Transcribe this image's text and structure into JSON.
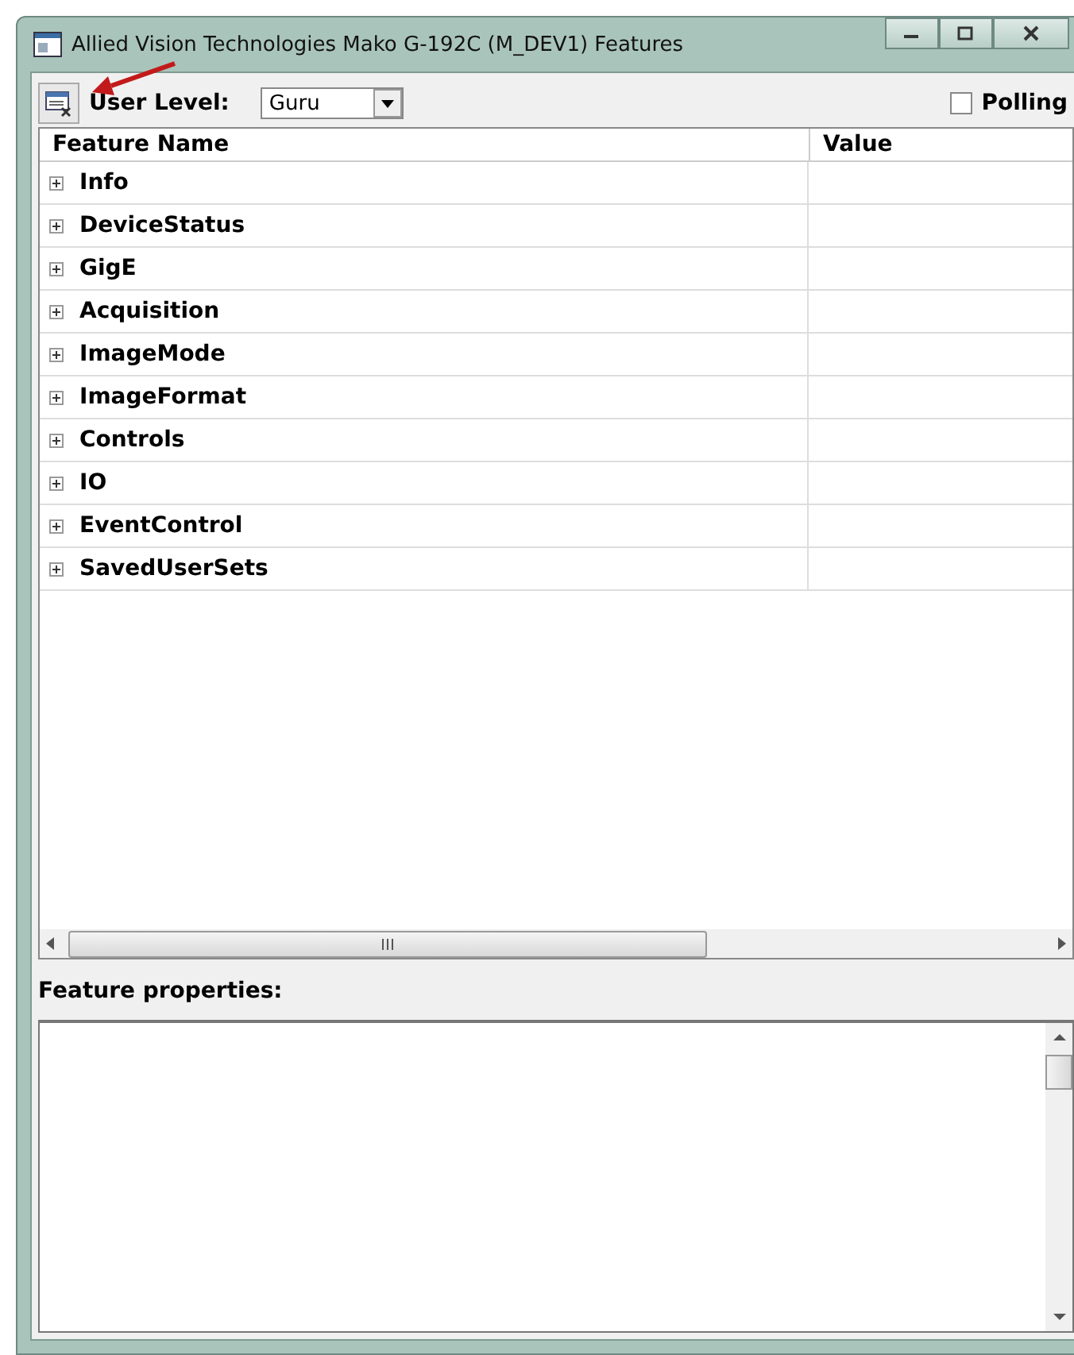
{
  "window": {
    "title": "Allied Vision Technologies Mako G-192C (M_DEV1) Features"
  },
  "toolbar": {
    "user_level_label": "User Level:",
    "user_level": "Guru",
    "polling": {
      "label": "Polling",
      "checked": false
    }
  },
  "table": {
    "columns": [
      "Feature Name",
      "Value"
    ],
    "rows": [
      {
        "name": "Info",
        "expanded": false
      },
      {
        "name": "DeviceStatus",
        "expanded": false
      },
      {
        "name": "GigE",
        "expanded": false
      },
      {
        "name": "Acquisition",
        "expanded": false
      },
      {
        "name": "ImageMode",
        "expanded": false
      },
      {
        "name": "ImageFormat",
        "expanded": false
      },
      {
        "name": "Controls",
        "expanded": false
      },
      {
        "name": "IO",
        "expanded": false
      },
      {
        "name": "EventControl",
        "expanded": false
      },
      {
        "name": "SavedUserSets",
        "expanded": false
      }
    ]
  },
  "properties": {
    "label": "Feature properties:"
  }
}
